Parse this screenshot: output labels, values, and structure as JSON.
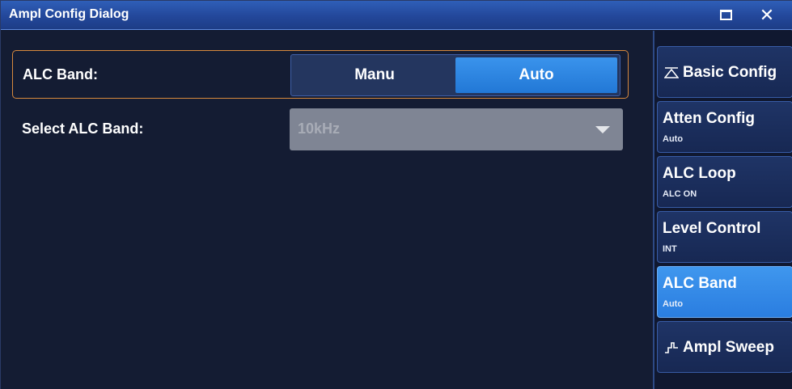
{
  "window": {
    "title": "Ampl Config Dialog"
  },
  "main": {
    "alc_band": {
      "label": "ALC Band:",
      "options": [
        "Manu",
        "Auto"
      ],
      "selected": "Auto"
    },
    "select_alc_band": {
      "label": "Select ALC Band:",
      "value": "10kHz",
      "enabled": false
    }
  },
  "sidebar": {
    "items": [
      {
        "label": "Basic Config",
        "icon": "collapse-triangle-icon"
      },
      {
        "label": "Atten Config",
        "value": "Auto"
      },
      {
        "label": "ALC Loop",
        "value": "ALC ON"
      },
      {
        "label": "Level Control",
        "value": "INT"
      },
      {
        "label": "ALC Band",
        "value": "Auto",
        "active": true
      },
      {
        "label": "Ampl Sweep",
        "icon": "step-waveform-icon"
      }
    ]
  },
  "colors": {
    "accent": "#2a7de0",
    "highlight_border": "#d8893d",
    "background": "#141c33"
  }
}
